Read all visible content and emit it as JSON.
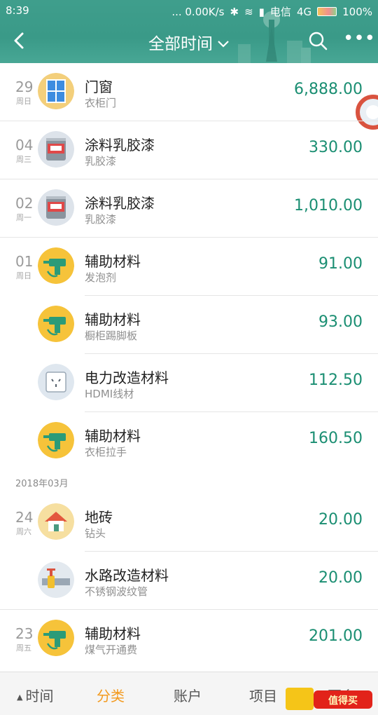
{
  "status_bar": {
    "time": "8:39",
    "network_speed": "... 0.00K/s",
    "carrier": "电信",
    "network": "4G",
    "battery": "100%"
  },
  "nav": {
    "title": "全部时间",
    "back_icon": "back-arrow-icon",
    "search_icon": "search-icon",
    "more_icon": "more-dots-icon"
  },
  "colors": {
    "header_bg": "#3f9e8c",
    "amount": "#1a8e72",
    "active_tab": "#f39a1e"
  },
  "records": [
    {
      "day": "29",
      "week": "周日",
      "icon": "window-icon",
      "name": "门窗",
      "sub": "衣柜门",
      "amount": "6,888.00"
    },
    {
      "day": "04",
      "week": "周三",
      "icon": "paint-bucket-icon",
      "name": "涂料乳胶漆",
      "sub": "乳胶漆",
      "amount": "330.00"
    },
    {
      "day": "02",
      "week": "周一",
      "icon": "paint-bucket-icon",
      "name": "涂料乳胶漆",
      "sub": "乳胶漆",
      "amount": "1,010.00"
    },
    {
      "day": "01",
      "week": "周日",
      "icon": "drill-icon",
      "name": "辅助材料",
      "sub": "发泡剂",
      "amount": "91.00"
    },
    {
      "day": "",
      "week": "",
      "icon": "drill-icon",
      "name": "辅助材料",
      "sub": "橱柜踢脚板",
      "amount": "93.00"
    },
    {
      "day": "",
      "week": "",
      "icon": "power-socket-icon",
      "name": "电力改造材料",
      "sub": "HDMI线材",
      "amount": "112.50"
    },
    {
      "day": "",
      "week": "",
      "icon": "drill-icon",
      "name": "辅助材料",
      "sub": "衣柜拉手",
      "amount": "160.50"
    }
  ],
  "month_label": "2018年03月",
  "records_march": [
    {
      "day": "24",
      "week": "周六",
      "icon": "house-icon",
      "name": "地砖",
      "sub": "钻头",
      "amount": "20.00"
    },
    {
      "day": "",
      "week": "",
      "icon": "water-pipe-icon",
      "name": "水路改造材料",
      "sub": "不锈钢波纹管",
      "amount": "20.00"
    },
    {
      "day": "23",
      "week": "周五",
      "icon": "drill-icon",
      "name": "辅助材料",
      "sub": "煤气开通费",
      "amount": "201.00"
    }
  ],
  "bottom_tabs": [
    {
      "label": "时间",
      "active": false
    },
    {
      "label": "分类",
      "active": true
    },
    {
      "label": "账户",
      "active": false
    },
    {
      "label": "项目",
      "active": false
    },
    {
      "label": "更多",
      "active": false
    }
  ],
  "watermark": "什么值得买"
}
